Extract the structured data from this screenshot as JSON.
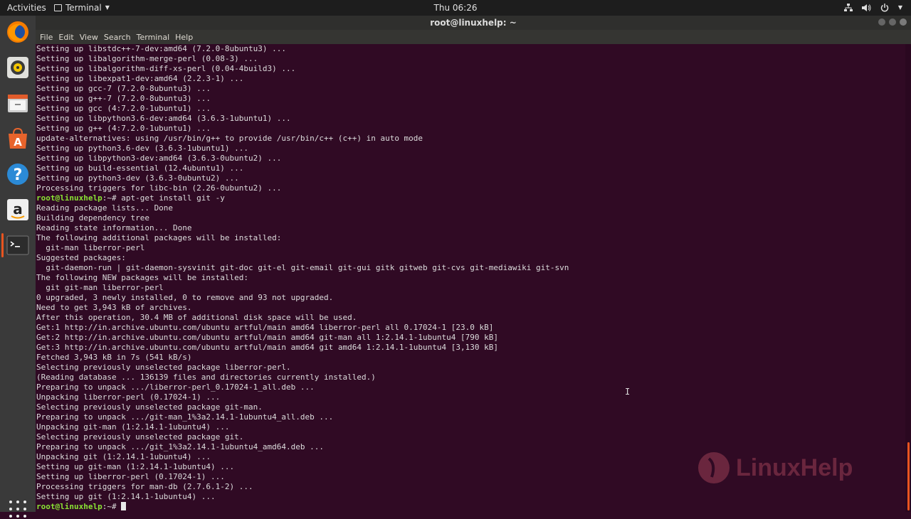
{
  "top_bar": {
    "activities": "Activities",
    "app_menu": "Terminal",
    "clock": "Thu 06:26",
    "tray": {
      "network_icon": "network-icon",
      "volume_icon": "volume-icon",
      "power_icon": "power-icon"
    }
  },
  "window": {
    "title": "root@linuxhelp: ~",
    "menu": [
      "File",
      "Edit",
      "View",
      "Search",
      "Terminal",
      "Help"
    ]
  },
  "dock": {
    "items": [
      "firefox-icon",
      "rhythmbox-icon",
      "files-icon",
      "software-center-icon",
      "help-icon",
      "amazon-icon",
      "terminal-icon"
    ],
    "show_apps": "apps-grid-icon"
  },
  "terminal": {
    "prompt": "root@linuxhelp",
    "prompt_suffix": ":~# ",
    "lines": [
      "Setting up libstdc++-7-dev:amd64 (7.2.0-8ubuntu3) ...",
      "Setting up libalgorithm-merge-perl (0.08-3) ...",
      "Setting up libalgorithm-diff-xs-perl (0.04-4build3) ...",
      "Setting up libexpat1-dev:amd64 (2.2.3-1) ...",
      "Setting up gcc-7 (7.2.0-8ubuntu3) ...",
      "Setting up g++-7 (7.2.0-8ubuntu3) ...",
      "Setting up gcc (4:7.2.0-1ubuntu1) ...",
      "Setting up libpython3.6-dev:amd64 (3.6.3-1ubuntu1) ...",
      "Setting up g++ (4:7.2.0-1ubuntu1) ...",
      "update-alternatives: using /usr/bin/g++ to provide /usr/bin/c++ (c++) in auto mode",
      "Setting up python3.6-dev (3.6.3-1ubuntu1) ...",
      "Setting up libpython3-dev:amd64 (3.6.3-0ubuntu2) ...",
      "Setting up build-essential (12.4ubuntu1) ...",
      "Setting up python3-dev (3.6.3-0ubuntu2) ...",
      "Processing triggers for libc-bin (2.26-0ubuntu2) ...",
      "Reading package lists... Done",
      "Building dependency tree",
      "Reading state information... Done",
      "The following additional packages will be installed:",
      "  git-man liberror-perl",
      "Suggested packages:",
      "  git-daemon-run | git-daemon-sysvinit git-doc git-el git-email git-gui gitk gitweb git-cvs git-mediawiki git-svn",
      "The following NEW packages will be installed:",
      "  git git-man liberror-perl",
      "0 upgraded, 3 newly installed, 0 to remove and 93 not upgraded.",
      "Need to get 3,943 kB of archives.",
      "After this operation, 30.4 MB of additional disk space will be used.",
      "Get:1 http://in.archive.ubuntu.com/ubuntu artful/main amd64 liberror-perl all 0.17024-1 [23.0 kB]",
      "Get:2 http://in.archive.ubuntu.com/ubuntu artful/main amd64 git-man all 1:2.14.1-1ubuntu4 [790 kB]",
      "Get:3 http://in.archive.ubuntu.com/ubuntu artful/main amd64 git amd64 1:2.14.1-1ubuntu4 [3,130 kB]",
      "Fetched 3,943 kB in 7s (541 kB/s)",
      "Selecting previously unselected package liberror-perl.",
      "(Reading database ... 136139 files and directories currently installed.)",
      "Preparing to unpack .../liberror-perl_0.17024-1_all.deb ...",
      "Unpacking liberror-perl (0.17024-1) ...",
      "Selecting previously unselected package git-man.",
      "Preparing to unpack .../git-man_1%3a2.14.1-1ubuntu4_all.deb ...",
      "Unpacking git-man (1:2.14.1-1ubuntu4) ...",
      "Selecting previously unselected package git.",
      "Preparing to unpack .../git_1%3a2.14.1-1ubuntu4_amd64.deb ...",
      "Unpacking git (1:2.14.1-1ubuntu4) ...",
      "Setting up git-man (1:2.14.1-1ubuntu4) ...",
      "Setting up liberror-perl (0.17024-1) ...",
      "Processing triggers for man-db (2.7.6.1-2) ...",
      "Setting up git (1:2.14.1-1ubuntu4) ..."
    ],
    "command_line_index": 15,
    "command": "apt-get install git -y",
    "final_command": ""
  },
  "watermark": {
    "text": "LinuxHelp"
  },
  "colors": {
    "background": "#300a24",
    "prompt": "#8ae234",
    "accent": "#e95420"
  }
}
